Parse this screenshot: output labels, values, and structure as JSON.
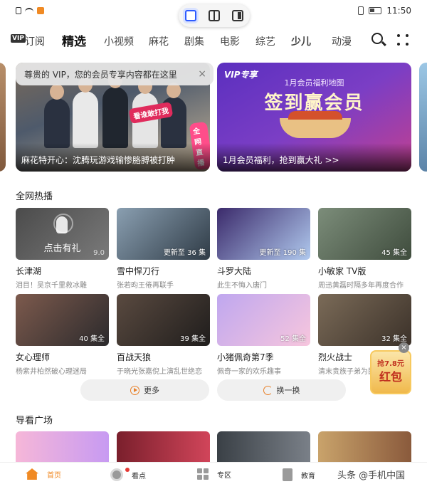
{
  "status_bar": {
    "time": "11:50"
  },
  "nav": {
    "vip_badge": "VIP",
    "vip_label": "订阅",
    "tabs": [
      "精选",
      "小视频",
      "麻花",
      "剧集",
      "电影",
      "综艺",
      "少儿",
      "动漫"
    ]
  },
  "vip_tip": {
    "text": "尊贵的 VIP，您的会员专享内容都在这里",
    "close": "×"
  },
  "banners": {
    "main": {
      "caption": "麻花特开心：沈腾玩游戏输惨胳膊被打肿",
      "stamp": "看谁敢打我",
      "stamp2": "全网直播"
    },
    "vip": {
      "logo": "VIP专享",
      "small": "1月会员福利地图",
      "big": "签到赢会员",
      "caption": "1月会员福利，抢到赢大礼 >>"
    }
  },
  "hot_section": {
    "title": "全网热播",
    "cards": [
      {
        "title": "长津湖",
        "sub": "泪目！吴京千里救冰雕",
        "overlay": "点击有礼",
        "score": "9.0",
        "colors": [
          "#4b4b4b",
          "#7a7a7a"
        ]
      },
      {
        "title": "雪中悍刀行",
        "sub": "张若昀王倦再联手",
        "badge": "更新至 36 集",
        "colors": [
          "#8a9fb1",
          "#2f3b46"
        ]
      },
      {
        "title": "斗罗大陆",
        "sub": "此生不悔入唐门",
        "badge": "更新至 190 集",
        "colors": [
          "#3b2a6b",
          "#b0c9ee"
        ]
      },
      {
        "title": "小敏家 TV版",
        "sub": "周迅黄磊时隔多年再度合作",
        "badge": "45 集全",
        "colors": [
          "#7c8d7a",
          "#3f4c3d"
        ]
      },
      {
        "title": "女心理师",
        "sub": "杨紫井柏然破心理迷局",
        "badge": "40 集全",
        "colors": [
          "#7d5a4d",
          "#2b2a2c"
        ]
      },
      {
        "title": "百战天狼",
        "sub": "于晓光张嘉倪上演乱世绝恋",
        "badge": "39 集全",
        "colors": [
          "#5a4a40",
          "#1f1d1c"
        ]
      },
      {
        "title": "小猪佩奇第7季",
        "sub": "佩奇一家的欢乐趣事",
        "badge": "52 集全",
        "colors": [
          "#bfa7ef",
          "#f7c6dd"
        ]
      },
      {
        "title": "烈火战士",
        "sub": "清末贵族子弟为民族",
        "badge": "32 集全",
        "colors": [
          "#7b6b58",
          "#3b3129"
        ]
      }
    ]
  },
  "buttons": {
    "more": "更多",
    "refresh": "换一换"
  },
  "red_packet": {
    "top": "抢7.8元",
    "main": "红包",
    "close": "×"
  },
  "guide_section": {
    "title": "导看广场"
  },
  "bottom_nav": {
    "home": "首页",
    "watch": "看点",
    "zone": "专区",
    "edu": "教育"
  },
  "watermark": "头条 @手机中国"
}
